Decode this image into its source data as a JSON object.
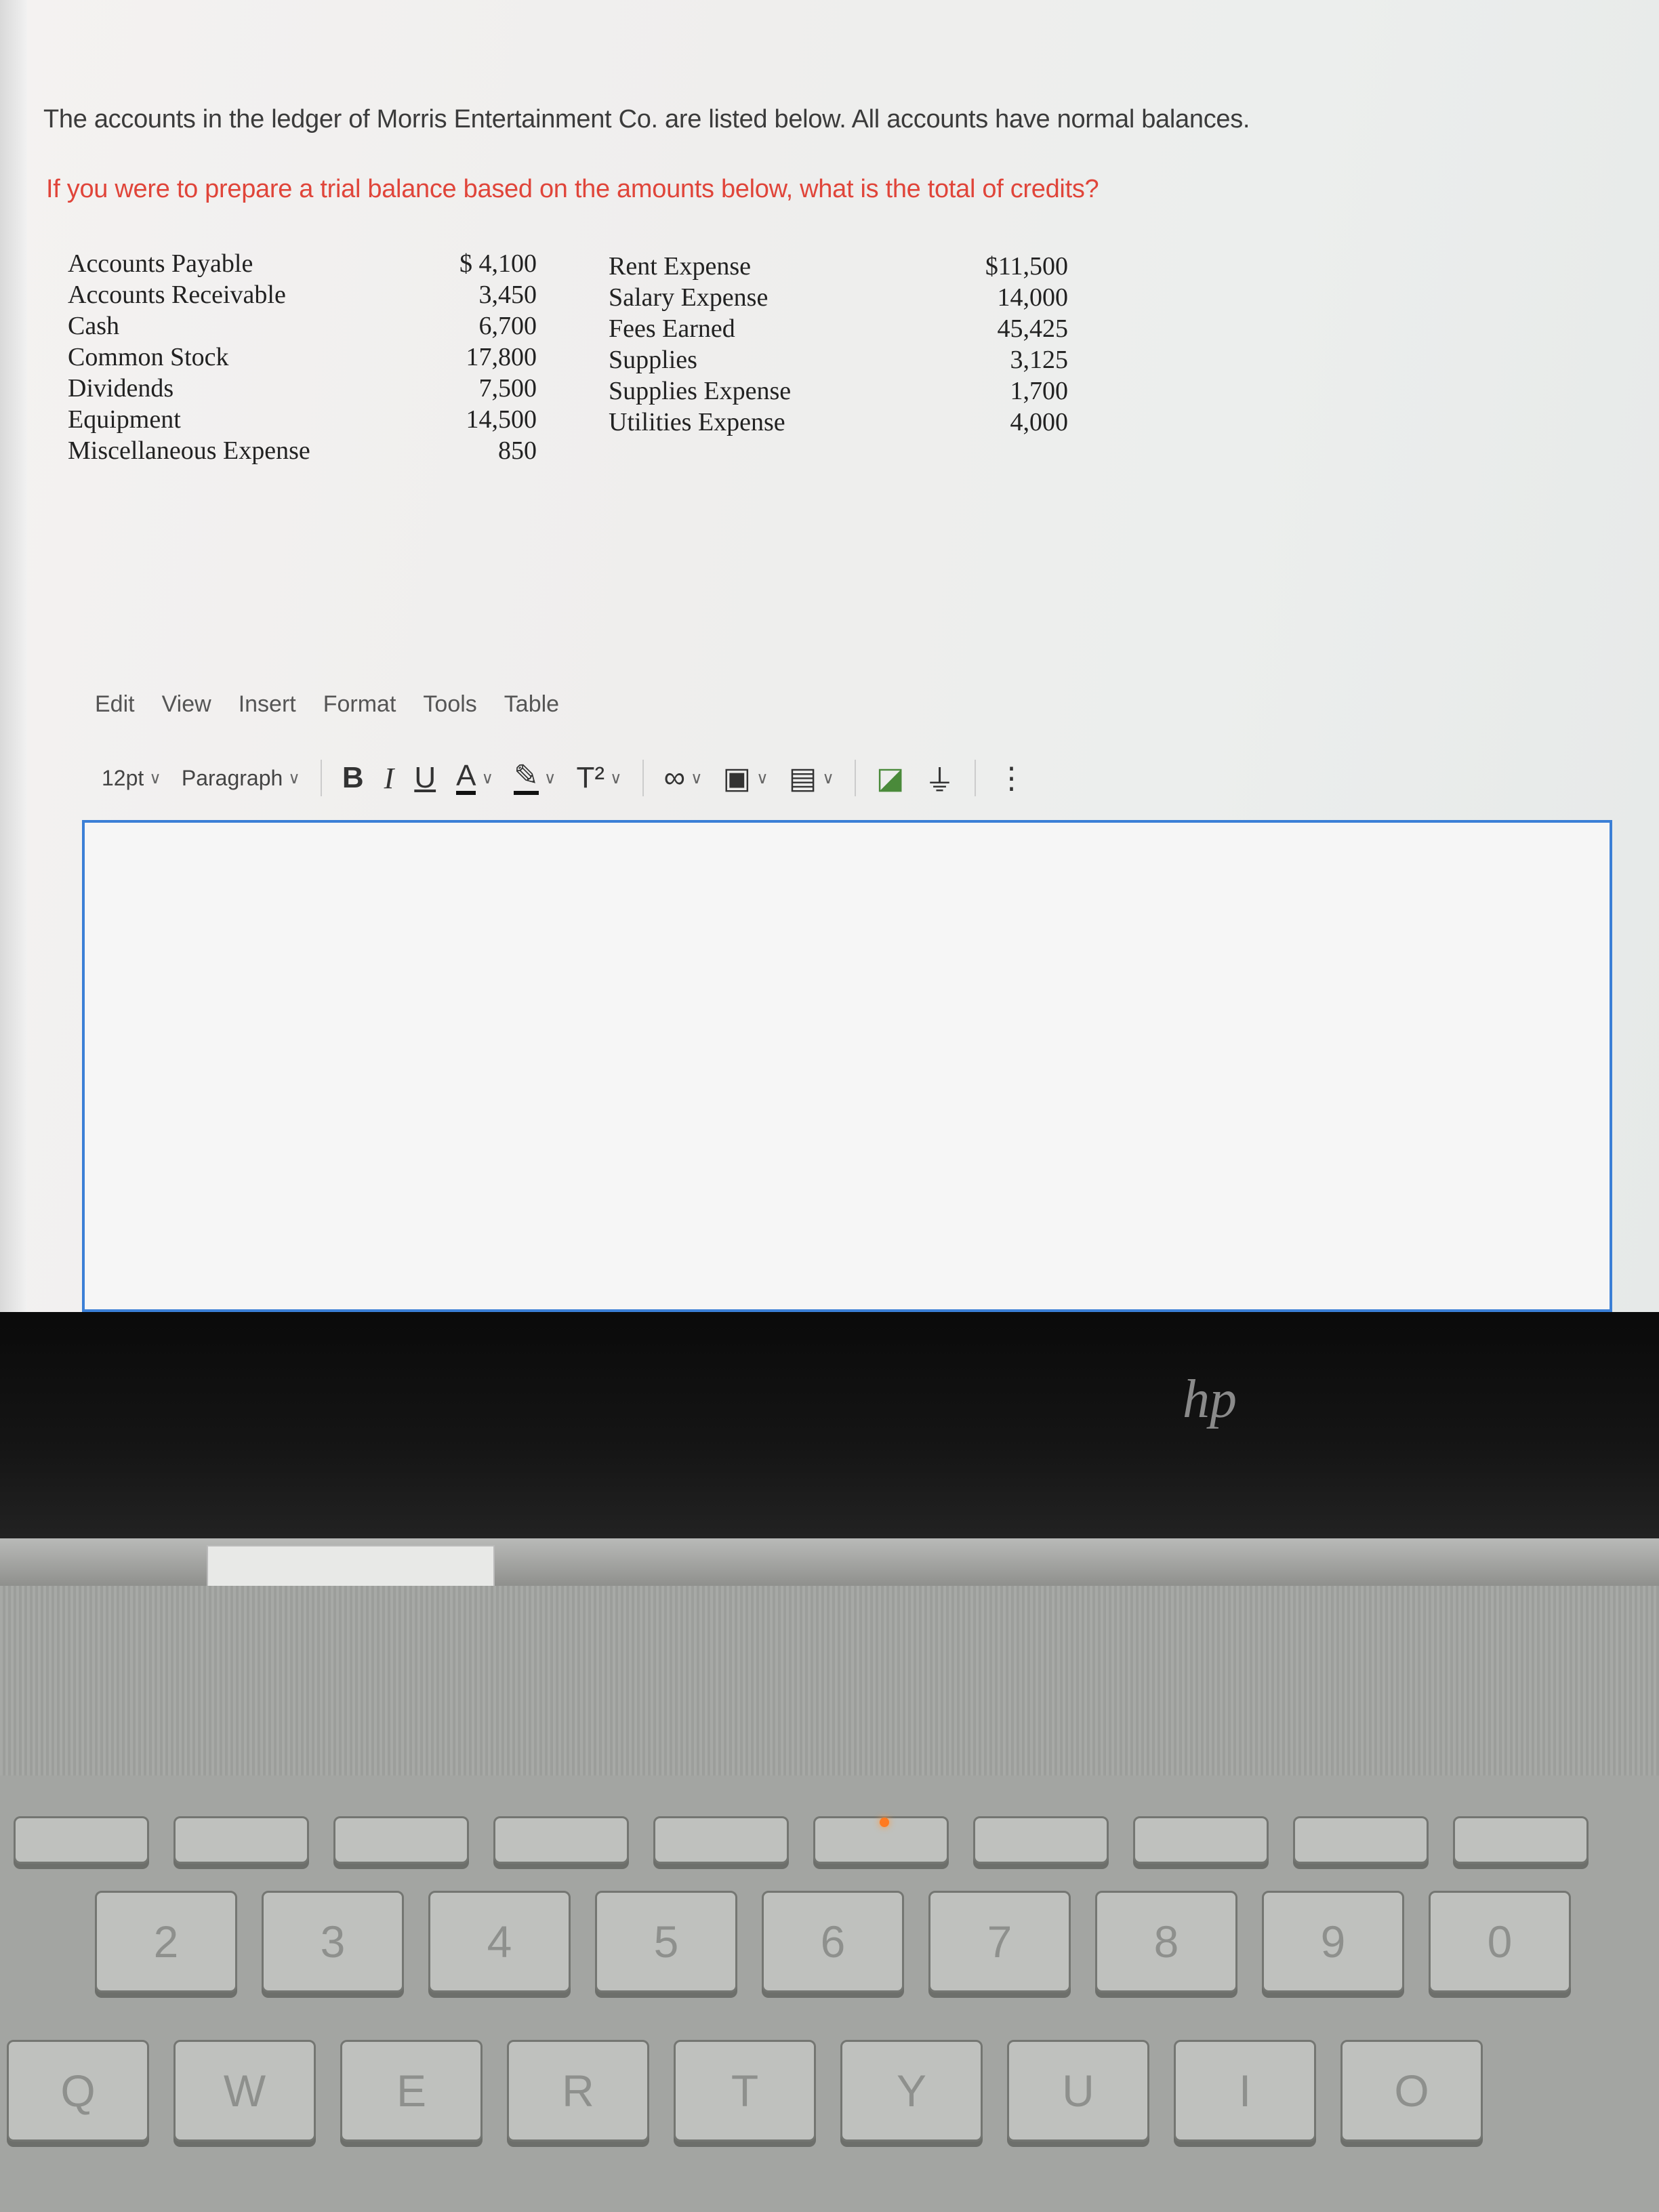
{
  "question": {
    "intro": "The accounts in the ledger of Morris Entertainment Co. are listed below. All accounts have normal balances.",
    "prompt": "If you were to prepare a trial balance based on the amounts below, what is the total of credits?",
    "accent_color": "#e0453a"
  },
  "ledger": {
    "left": [
      {
        "account": "Accounts Payable",
        "amount": "$ 4,100"
      },
      {
        "account": "Accounts Receivable",
        "amount": "3,450"
      },
      {
        "account": "Cash",
        "amount": "6,700"
      },
      {
        "account": "Common Stock",
        "amount": "17,800"
      },
      {
        "account": "Dividends",
        "amount": "7,500"
      },
      {
        "account": "Equipment",
        "amount": "14,500"
      },
      {
        "account": "Miscellaneous Expense",
        "amount": "850"
      }
    ],
    "right": [
      {
        "account": "Rent Expense",
        "amount": "$11,500"
      },
      {
        "account": "Salary Expense",
        "amount": "14,000"
      },
      {
        "account": "Fees Earned",
        "amount": "45,425"
      },
      {
        "account": "Supplies",
        "amount": "3,125"
      },
      {
        "account": "Supplies Expense",
        "amount": "1,700"
      },
      {
        "account": "Utilities Expense",
        "amount": "4,000"
      }
    ]
  },
  "editor": {
    "menu": [
      "Edit",
      "View",
      "Insert",
      "Format",
      "Tools",
      "Table"
    ],
    "font_size": "12pt",
    "block_format": "Paragraph",
    "bold": "B",
    "italic": "I",
    "underline": "U",
    "text_color": "A",
    "superscript": "T²",
    "more": "⋮",
    "content": "",
    "focus_color": "#3b7fd6"
  },
  "laptop": {
    "brand_logo": "hp",
    "number_keys": [
      "2",
      "3",
      "4",
      "5",
      "6",
      "7",
      "8",
      "9",
      "0"
    ],
    "letter_keys": [
      "Q",
      "W",
      "E",
      "R",
      "T",
      "Y",
      "U",
      "I",
      "O"
    ]
  }
}
